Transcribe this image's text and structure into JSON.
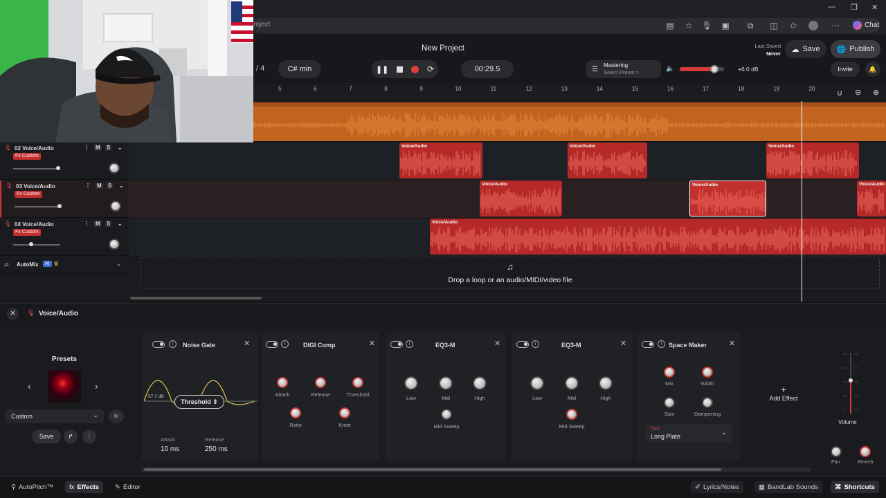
{
  "browser": {
    "address": "roject",
    "chat_label": "Chat"
  },
  "header": {
    "project_title": "New Project",
    "bars": "/ 4",
    "key": "C# min",
    "time": "00:29.5",
    "mastering_label": "Mastering",
    "mastering_sub": "Select Preset >",
    "volume_db": "+6.0 dB",
    "volume_level": 0.78,
    "last_saved_label": "Last Saved",
    "last_saved_value": "Never",
    "save_label": "Save",
    "publish_label": "Publish",
    "invite_label": "Invite"
  },
  "ruler": [
    "5",
    "6",
    "7",
    "8",
    "9",
    "10",
    "11",
    "12",
    "13",
    "14",
    "15",
    "16",
    "17",
    "18",
    "19",
    "20"
  ],
  "tracks": [
    {
      "name": "02 Voice/Audio",
      "fx": "Fx Custom",
      "m": "M",
      "s": "S",
      "volume": 0.95
    },
    {
      "name": "03 Voice/Audio",
      "fx": "Fx Custom",
      "m": "M",
      "s": "S",
      "volume": 0.95
    },
    {
      "name": "04 Voice/Audio",
      "fx": "Fx Custom",
      "m": "M",
      "s": "S",
      "volume": 0.38
    }
  ],
  "automix": {
    "label": "AutoMix",
    "badge": "AI"
  },
  "clip_label": "Voice/Audio",
  "drop_text": "Drop a loop or an audio/MIDI/video file",
  "panel": {
    "title": "Voice/Audio"
  },
  "presets": {
    "title": "Presets",
    "selected": "Custom",
    "save": "Save"
  },
  "effects": [
    {
      "name": "Noise Gate",
      "knobs": [],
      "threshold_label": "Threshold",
      "threshold_value": "-57.7 dB",
      "attack_label": "Attack",
      "attack_value": "10 ms",
      "release_label": "Release",
      "release_value": "250 ms"
    },
    {
      "name": "DIGI Comp",
      "knobs": [
        "Attack",
        "Release",
        "Threshold",
        "Ratio",
        "Knee"
      ]
    },
    {
      "name": "EQ3-M",
      "knobs": [
        "Low",
        "Mid",
        "High",
        "Mid Sweep"
      ]
    },
    {
      "name": "EQ3-M",
      "knobs": [
        "Low",
        "Mid",
        "High",
        "Mid Sweep"
      ]
    },
    {
      "name": "Space Maker",
      "knobs": [
        "Mix",
        "Width",
        "Size",
        "Dampening"
      ],
      "type_label": "Type",
      "type_value": "Long Plate"
    }
  ],
  "add_effect": "Add Effect",
  "master": {
    "volume": "Volume",
    "pan": "Pan",
    "reverb": "Reverb",
    "volume_level": 0.55
  },
  "bottom": {
    "autopitch": "AutoPitch™",
    "effects": "Effects",
    "editor": "Editor",
    "lyrics": "Lyrics/Notes",
    "bandlab": "BandLab Sounds",
    "shortcuts": "Shortcuts"
  },
  "icons": [
    "search-icon",
    "star-icon",
    "mic-icon",
    "settings-icon",
    "close-icon",
    "pause-icon",
    "stop-icon",
    "record-icon",
    "loop-icon",
    "speaker-icon",
    "bell-icon",
    "zoom-in-icon",
    "zoom-out-icon",
    "magnet-icon",
    "globe-icon",
    "cloud-icon"
  ]
}
